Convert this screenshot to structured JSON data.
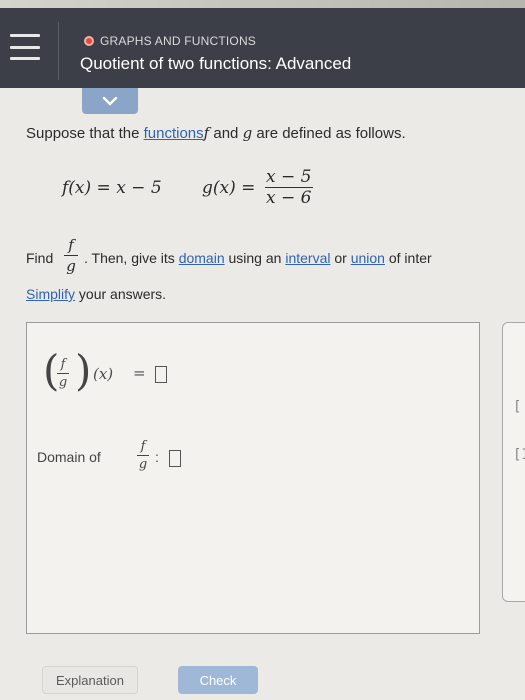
{
  "header": {
    "topic": "GRAPHS AND FUNCTIONS",
    "title": "Quotient of two functions: Advanced",
    "topic_dot_color": "#e24a3b"
  },
  "problem": {
    "intro_pre": "Suppose that the ",
    "intro_link": "functions",
    "intro_f": "f",
    "intro_and": " and ",
    "intro_g": "g",
    "intro_post": " are defined as follows.",
    "f_def": "f(x) = x − 5",
    "g_lhs": "g(x) =",
    "g_num": "x − 5",
    "g_den": "x − 6",
    "find_label": "Find",
    "find_num": "f",
    "find_den": "g",
    "find_text1": ". Then, give its ",
    "find_link_domain": "domain",
    "find_text2": " using an ",
    "find_link_interval": "interval",
    "find_text3": " or ",
    "find_link_union": "union",
    "find_text4": " of inter",
    "simplify_link": "Simplify",
    "simplify_rest": " your answers."
  },
  "answer": {
    "quotient_num": "f",
    "quotient_den": "g",
    "quotient_arg": "(x)",
    "equals": "=",
    "domain_label": "Domain of",
    "domain_num": "f",
    "domain_den": "g",
    "domain_colon": ":"
  },
  "side_panel": {
    "bracket1": "[",
    "bracket2": "[I"
  },
  "buttons": {
    "explanation": "Explanation",
    "check": "Check"
  },
  "colors": {
    "header_bg": "#3c3f47",
    "link": "#2f63b3",
    "check_button": "#9fb8d8"
  }
}
